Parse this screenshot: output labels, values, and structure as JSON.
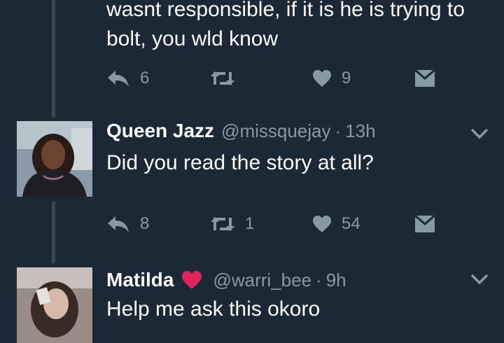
{
  "tweet1": {
    "text_lines": [
      "wasnt responsible, if it is he is trying to",
      "bolt, you wld know"
    ],
    "reply_count": "6",
    "retweet_count": "",
    "like_count": "9"
  },
  "tweet2": {
    "name": "Queen Jazz",
    "handle": "@missquejay",
    "separator": "·",
    "time": "13h",
    "text": "Did you read the story at all?",
    "reply_count": "8",
    "retweet_count": "1",
    "like_count": "54"
  },
  "tweet3": {
    "name": "Matilda",
    "handle": "@warri_bee",
    "separator": "·",
    "time": "9h",
    "text": "Help me ask this okoro"
  },
  "colors": {
    "background": "#1b2836",
    "muted": "#8899a6",
    "thread_line": "#3a4856",
    "heart_pink": "#e0245e"
  },
  "icons": [
    "reply-icon",
    "retweet-icon",
    "like-heart-icon",
    "direct-message-icon",
    "chevron-down-icon",
    "pink-heart-emoji-icon"
  ]
}
